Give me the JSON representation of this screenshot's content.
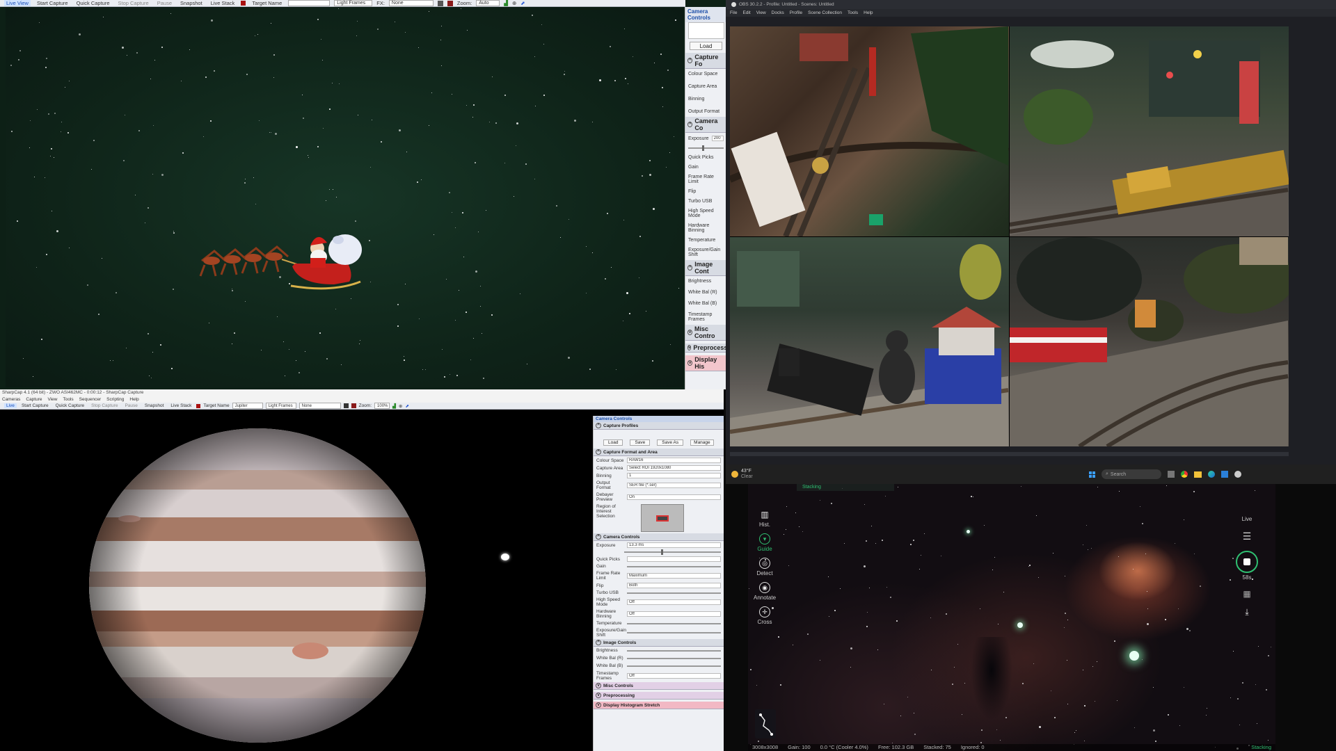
{
  "sharpcap_top": {
    "toolbar": {
      "live_view": "Live View",
      "start_capture": "Start Capture",
      "quick_capture": "Quick Capture",
      "stop_capture": "Stop Capture",
      "pause": "Pause",
      "snapshot": "Snapshot",
      "live_stack": "Live Stack",
      "target_name": "Target Name",
      "light_frames": "Light Frames",
      "fx_label": "FX:",
      "fx_value": "None",
      "zoom_label": "Zoom:",
      "zoom_value": "Auto"
    },
    "panel": {
      "header": "Camera Controls",
      "load": "Load",
      "sections": {
        "capture_format": "Capture Fo",
        "camera_controls": "Camera Co",
        "image_controls": "Image Cont",
        "misc_controls": "Misc Contro",
        "preprocessing": "Preprocess",
        "display_histogram": "Display His"
      },
      "labels": {
        "colour_space": "Colour Space",
        "capture_area": "Capture Area",
        "binning": "Binning",
        "output_format": "Output Format",
        "exposure": "Exposure",
        "exposure_value": "200",
        "quick_picks": "Quick Picks",
        "gain": "Gain",
        "frame_rate_limit": "Frame Rate Limit",
        "flip": "Flip",
        "turbo_usb": "Turbo USB",
        "high_speed_mode": "High Speed Mode",
        "hardware_binning": "Hardware Binning",
        "temperature": "Temperature",
        "exposure_gain_shift": "Exposure/Gain Shift",
        "brightness": "Brightness",
        "white_bal_r": "White Bal (R)",
        "white_bal_b": "White Bal (B)",
        "timestamp_frames": "Timestamp Frames"
      }
    }
  },
  "sharpcap_bottom": {
    "title": "SharpCap 4.1 (64 bit) - ZWO ASI462MC - 0:00:12 - SharpCap Capture",
    "menu": [
      "Cameras",
      "Capture",
      "View",
      "Tools",
      "Sequencer",
      "Scripting",
      "Help"
    ],
    "toolbar": {
      "live_view": "Live",
      "start_capture": "Start Capture",
      "quick_capture": "Quick Capture",
      "stop_capture": "Stop Capture",
      "pause": "Pause",
      "snapshot": "Snapshot",
      "live_stack": "Live Stack",
      "target_name": "Target Name",
      "target_value": "Jupiter",
      "light_frames": "Light Frames",
      "fx_value": "None",
      "zoom_label": "Zoom:",
      "zoom_value": "100%"
    },
    "panel": {
      "header": "Camera Controls",
      "capture_profiles": "Capture Profiles",
      "buttons": [
        "Load",
        "Save",
        "Save As",
        "Manage"
      ],
      "capture_format_area": "Capture Format and Area",
      "colour_space": "Colour Space",
      "colour_space_value": "RAW16",
      "capture_area": "Capture Area",
      "capture_area_value": "Select ROI 1920x1080",
      "binning": "Binning",
      "binning_value": "1",
      "output_format": "Output Format",
      "output_format_value": "SER file (*.ser)",
      "debayer_preview": "Debayer Preview",
      "debayer_preview_value": "On",
      "region_of_interest": "Region of Interest Selection",
      "camera_controls": "Camera Controls",
      "exposure": "Exposure",
      "exposure_value": "13.3 ms",
      "quick_picks": "Quick Picks",
      "gain": "Gain",
      "frame_rate_limit": "Frame Rate Limit",
      "frame_rate_value": "Maximum",
      "flip": "Flip",
      "flip_value": "Both",
      "turbo_usb": "Turbo USB",
      "high_speed_mode": "High Speed Mode",
      "high_speed_value": "Off",
      "hardware_binning": "Hardware Binning",
      "hardware_binning_value": "Off",
      "temperature": "Temperature",
      "exposure_gain_shift": "Exposure/Gain Shift",
      "image_controls": "Image Controls",
      "brightness": "Brightness",
      "white_bal_r": "White Bal (R)",
      "white_bal_b": "White Bal (B)",
      "timestamp_frames": "Timestamp Frames",
      "timestamp_value": "Off",
      "misc_controls": "Misc Controls",
      "preprocessing": "Preprocessing",
      "display_histogram": "Display Histogram Stretch"
    }
  },
  "obs": {
    "title": "OBS 30.2.2 - Profile: Untitled - Scenes: Untitled",
    "menu": [
      "File",
      "Edit",
      "View",
      "Docks",
      "Profile",
      "Scene Collection",
      "Tools",
      "Help"
    ]
  },
  "taskbar": {
    "weather_temp": "43°F",
    "weather_text": "Clear",
    "search_placeholder": "Search"
  },
  "seestar": {
    "tools": [
      {
        "label": "Hist.",
        "icon": "histogram-icon"
      },
      {
        "label": "Guide",
        "icon": "guide-icon"
      },
      {
        "label": "Detect",
        "icon": "detect-icon"
      },
      {
        "label": "Annotate",
        "icon": "annotate-icon"
      },
      {
        "label": "Cross",
        "icon": "crosshair-icon"
      }
    ],
    "top_banner": "Stacking",
    "live_label": "Live",
    "timer": "58s",
    "status": {
      "resolution": "3008x3008",
      "gain": "Gain: 100",
      "temp": "0.0 °C (Cooler 4.0%)",
      "free": "Free: 102.3 GB",
      "stacked": "Stacked: 75",
      "ignored": "Ignored: 0",
      "state": "Stacking"
    },
    "accent": "#2fbf71"
  }
}
